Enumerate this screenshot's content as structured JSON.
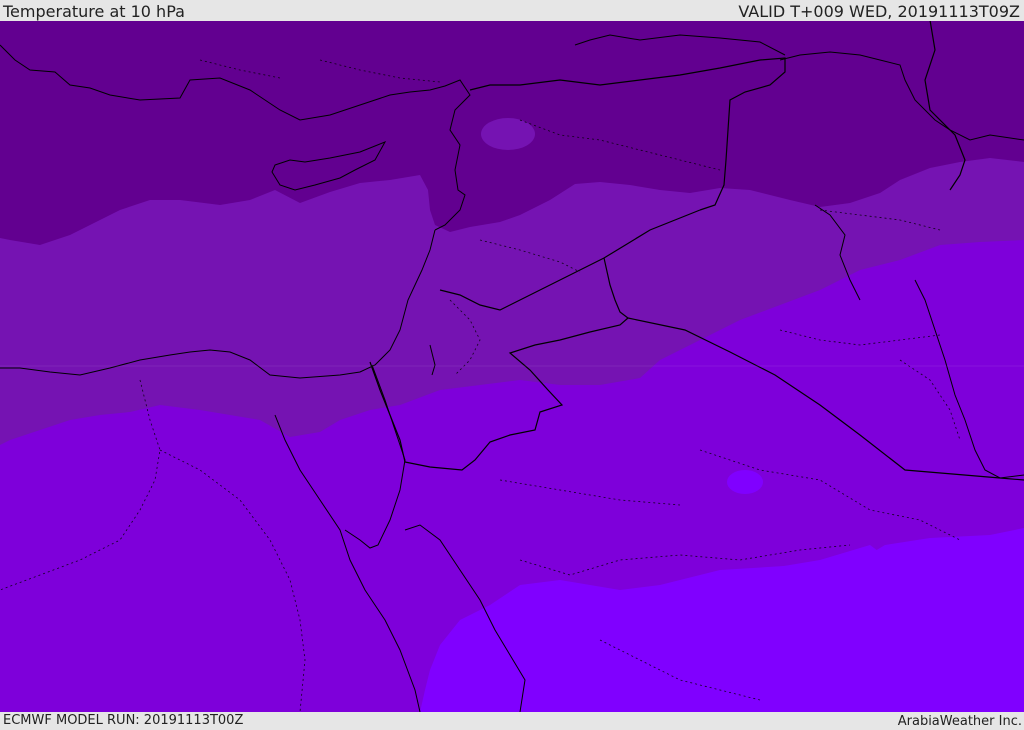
{
  "header": {
    "title": "Temperature at 10 hPa",
    "valid": "VALID T+009 WED, 20191113T09Z"
  },
  "footer": {
    "model_run": "ECMWF MODEL RUN: 20191113T00Z",
    "credit": "ArabiaWeather Inc."
  },
  "map": {
    "region": "Eastern Mediterranean, Levant, Egypt and Northern Arabia",
    "field": "temperature",
    "level": "10 hPa",
    "palette": {
      "band_darkest": "#620090",
      "band_dark": "#7513b2",
      "band_mid": "#7e00da",
      "band_light": "#8000ff",
      "coastline": "#000000",
      "borders": "#000000"
    }
  }
}
